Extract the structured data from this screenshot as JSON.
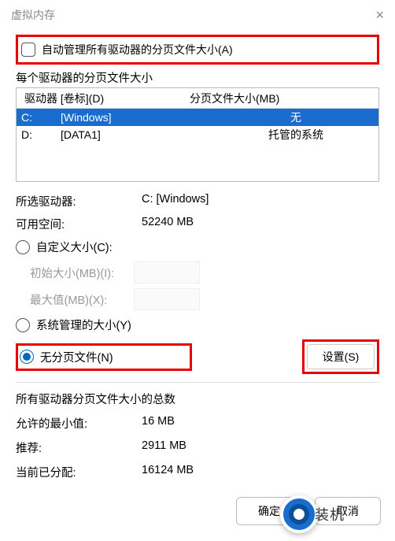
{
  "titlebar": {
    "title": "虚拟内存"
  },
  "auto_manage": {
    "label": "自动管理所有驱动器的分页文件大小(A)"
  },
  "drive_section": {
    "label": "每个驱动器的分页文件大小",
    "header_drive": "驱动器 [卷标](D)",
    "header_pf": "分页文件大小(MB)",
    "rows": [
      {
        "drive": "C:",
        "label": "[Windows]",
        "pf": "无",
        "selected": true
      },
      {
        "drive": "D:",
        "label": "[DATA1]",
        "pf": "托管的系统",
        "selected": false
      }
    ]
  },
  "info": {
    "selected_label": "所选驱动器:",
    "selected_value": "C:  [Windows]",
    "free_label": "可用空间:",
    "free_value": "52240 MB"
  },
  "options": {
    "custom": "自定义大小(C):",
    "initial": "初始大小(MB)(I):",
    "max": "最大值(MB)(X):",
    "system": "系统管理的大小(Y)",
    "nopage": "无分页文件(N)",
    "set_btn": "设置(S)"
  },
  "totals": {
    "section": "所有驱动器分页文件大小的总数",
    "min_label": "允许的最小值:",
    "min_value": "16 MB",
    "rec_label": "推荐:",
    "rec_value": "2911 MB",
    "cur_label": "当前已分配:",
    "cur_value": "16124 MB"
  },
  "footer": {
    "ok": "确定",
    "cancel": "取消"
  },
  "watermark": "装机"
}
